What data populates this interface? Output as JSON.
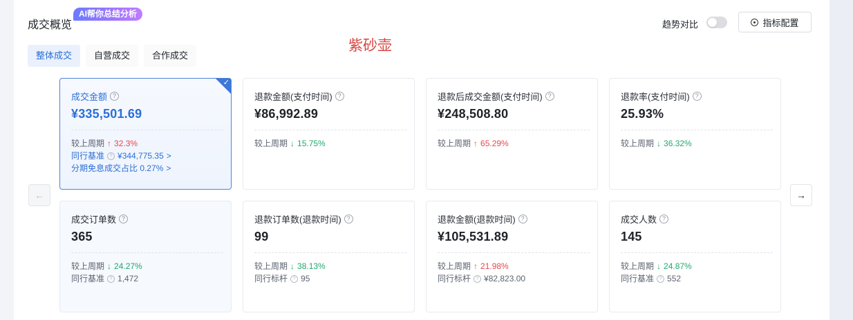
{
  "header": {
    "title": "成交概览",
    "ai_badge": "AI帮你总结分析",
    "watermark": "紫砂壶",
    "trend_compare_label": "趋势对比",
    "trend_compare_on": false,
    "config_button_label": "指标配置",
    "config_icon": "settings-circle-icon"
  },
  "tabs": [
    {
      "label": "整体成交",
      "active": true
    },
    {
      "label": "自营成交",
      "active": false
    },
    {
      "label": "合作成交",
      "active": false
    }
  ],
  "nav": {
    "prev_icon": "arrow-left-icon",
    "prev_glyph": "←",
    "next_icon": "arrow-right-icon",
    "next_glyph": "→"
  },
  "glyphs": {
    "help": "?",
    "up": "↑",
    "down": "↓",
    "chevron": ">",
    "check": "✓"
  },
  "cards": [
    {
      "label": "成交金额",
      "value": "¥335,501.69",
      "selected": true,
      "compare_label": "较上周期",
      "compare_dir": "up",
      "compare_value": "32.3%",
      "bench_label": "同行基准",
      "bench_value": "¥344,775.35",
      "extra_label": "分期免息成交占比 0.27%"
    },
    {
      "label": "退款金额(支付时间)",
      "value": "¥86,992.89",
      "compare_label": "较上周期",
      "compare_dir": "down",
      "compare_value": "15.75%"
    },
    {
      "label": "退款后成交金额(支付时间)",
      "value": "¥248,508.80",
      "compare_label": "较上周期",
      "compare_dir": "up",
      "compare_value": "65.29%"
    },
    {
      "label": "退款率(支付时间)",
      "value": "25.93%",
      "compare_label": "较上周期",
      "compare_dir": "down",
      "compare_value": "36.32%"
    },
    {
      "label": "成交订单数",
      "value": "365",
      "compare_label": "较上周期",
      "compare_dir": "down",
      "compare_value": "24.27%",
      "bench_label": "同行基准",
      "bench_value": "1,472"
    },
    {
      "label": "退款订单数(退款时间)",
      "value": "99",
      "compare_label": "较上周期",
      "compare_dir": "down",
      "compare_value": "38.13%",
      "bench_label": "同行标杆",
      "bench_value": "95"
    },
    {
      "label": "退款金额(退款时间)",
      "value": "¥105,531.89",
      "compare_label": "较上周期",
      "compare_dir": "up",
      "compare_value": "21.98%",
      "bench_label": "同行标杆",
      "bench_value": "¥82,823.00"
    },
    {
      "label": "成交人数",
      "value": "145",
      "compare_label": "较上周期",
      "compare_dir": "down",
      "compare_value": "24.87%",
      "bench_label": "同行基准",
      "bench_value": "552"
    }
  ],
  "colors": {
    "accent": "#2b6fd6",
    "up": "#e5484d",
    "down": "#22a86b",
    "watermark": "#d64541"
  }
}
